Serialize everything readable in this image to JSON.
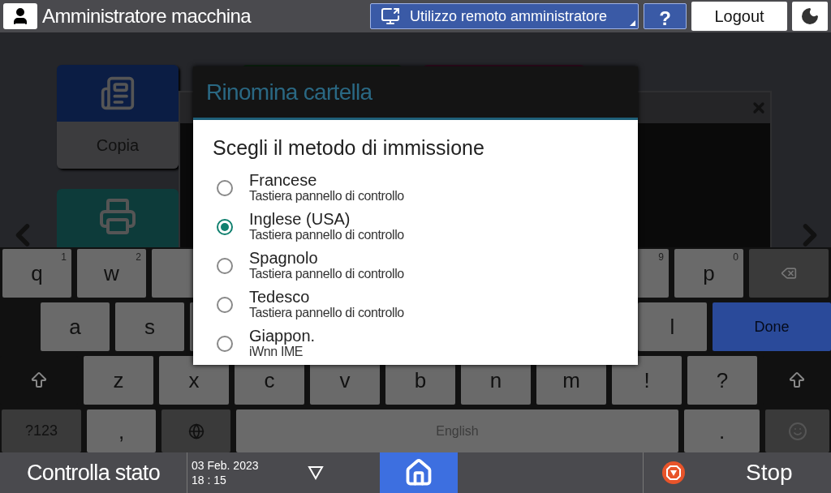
{
  "top_bar": {
    "title": "Amministratore macchina",
    "remote_button": "Utilizzo remoto amministratore",
    "help_button": "?",
    "logout_button": "Logout"
  },
  "home_tiles": [
    {
      "label": "Copia"
    }
  ],
  "dialog": {
    "title": "Rinomina cartella",
    "heading": "Scegli il metodo di immissione",
    "options": [
      {
        "name": "Francese",
        "detail": "Tastiera pannello di controllo",
        "selected": false
      },
      {
        "name": "Inglese (USA)",
        "detail": "Tastiera pannello di controllo",
        "selected": true
      },
      {
        "name": "Spagnolo",
        "detail": "Tastiera pannello di controllo",
        "selected": false
      },
      {
        "name": "Tedesco",
        "detail": "Tastiera pannello di controllo",
        "selected": false
      },
      {
        "name": "Giappon.",
        "detail": "iWnn IME",
        "selected": false
      }
    ]
  },
  "keyboard": {
    "rows": [
      {
        "keys": [
          {
            "kind": "char",
            "label": "q",
            "hint": "1"
          },
          {
            "kind": "char",
            "label": "w",
            "hint": "2"
          },
          {
            "kind": "blank"
          },
          {
            "kind": "hidden"
          },
          {
            "kind": "hidden"
          },
          {
            "kind": "hidden"
          },
          {
            "kind": "hidden"
          },
          {
            "kind": "blank"
          },
          {
            "kind": "char",
            "hint": "9"
          },
          {
            "kind": "char",
            "label": "p",
            "hint": "0"
          },
          {
            "kind": "backspace"
          }
        ]
      },
      {
        "keys": [
          {
            "kind": "char",
            "label": "a"
          },
          {
            "kind": "char",
            "label": "s"
          },
          {
            "kind": "blank"
          },
          {
            "kind": "blank"
          },
          {
            "kind": "blank"
          },
          {
            "kind": "blank"
          },
          {
            "kind": "blank"
          },
          {
            "kind": "blank"
          },
          {
            "kind": "char",
            "label": "l"
          },
          {
            "kind": "done",
            "label": "Done"
          }
        ]
      },
      {
        "keys": [
          {
            "kind": "shift"
          },
          {
            "kind": "char",
            "label": "z"
          },
          {
            "kind": "char",
            "label": "x"
          },
          {
            "kind": "char",
            "label": "c"
          },
          {
            "kind": "char",
            "label": "v"
          },
          {
            "kind": "char",
            "label": "b"
          },
          {
            "kind": "char",
            "label": "n"
          },
          {
            "kind": "char",
            "label": "m"
          },
          {
            "kind": "char",
            "label": "!"
          },
          {
            "kind": "char",
            "label": "?"
          },
          {
            "kind": "shift"
          }
        ]
      },
      {
        "keys": [
          {
            "kind": "mode",
            "label": "?123"
          },
          {
            "kind": "char",
            "label": ","
          },
          {
            "kind": "globe"
          },
          {
            "kind": "space",
            "label": "English"
          },
          {
            "kind": "char",
            "label": "."
          },
          {
            "kind": "emoji"
          }
        ]
      }
    ]
  },
  "bottom_bar": {
    "status_button": "Controlla stato",
    "date": "03 Feb. 2023",
    "time": "18 : 15",
    "stop_button": "Stop"
  }
}
